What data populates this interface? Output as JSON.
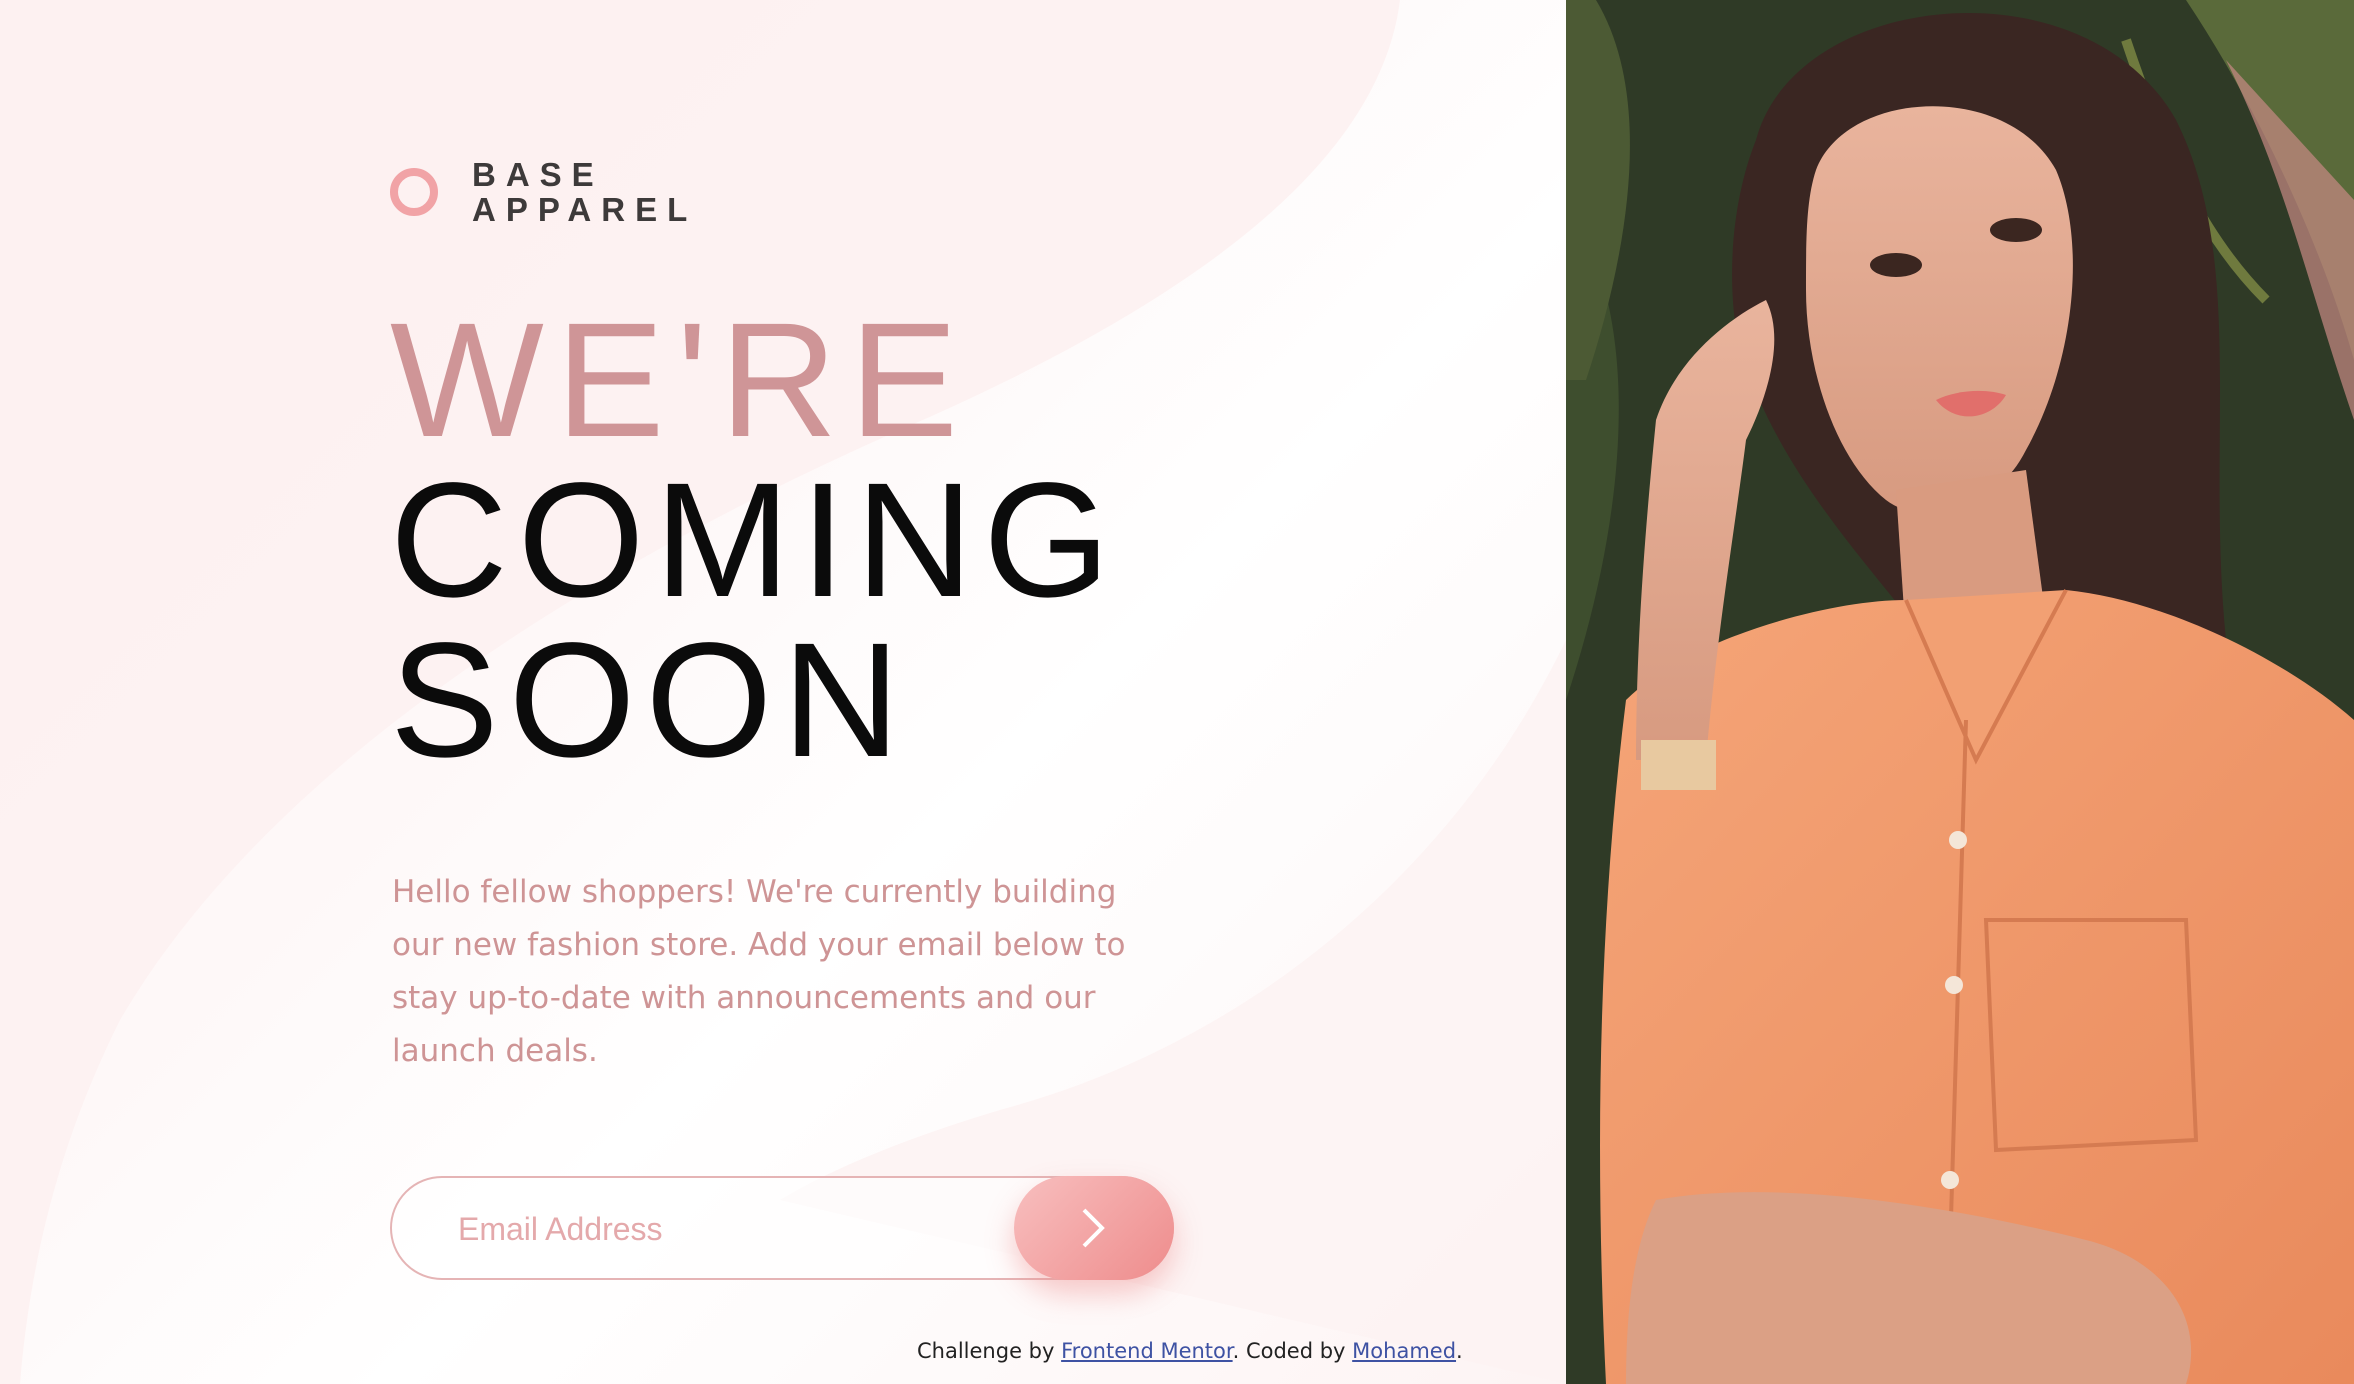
{
  "brand": {
    "line1": "BASE",
    "line2": "APPAREL"
  },
  "hero": {
    "line1": "WE'RE",
    "line2": "COMING",
    "line3": "SOON"
  },
  "description": "Hello fellow shoppers! We're currently building our new fashion store. Add your email below to stay up-to-date with announcements and our launch deals.",
  "form": {
    "email_placeholder": "Email Address",
    "submit_icon": "chevron-right-icon"
  },
  "attribution": {
    "prefix": "Challenge by ",
    "link1": "Frontend Mentor",
    "middle": ". Coded by ",
    "link2": "Mohamed",
    "suffix": "."
  },
  "colors": {
    "accent": "#ce9495",
    "button_start": "#f8bfbf",
    "button_end": "#ee8c8c",
    "dark_text": "#3d3a3a"
  }
}
